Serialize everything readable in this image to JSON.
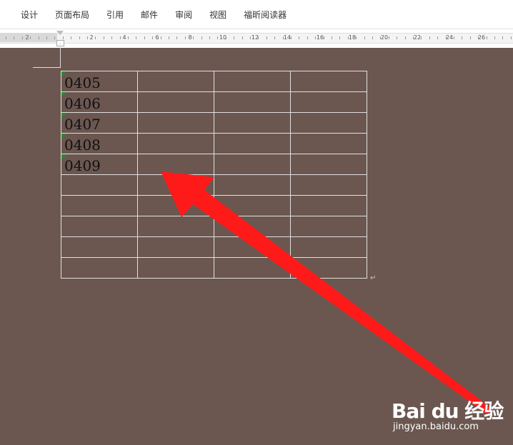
{
  "menu": [
    "设计",
    "页面布局",
    "引用",
    "邮件",
    "审阅",
    "视图",
    "福昕阅读器"
  ],
  "ruler": {
    "labels": [
      "2",
      "",
      "2",
      "4",
      "6",
      "8",
      "10",
      "12",
      "14",
      "16",
      "18",
      "20",
      "22",
      "24",
      "26"
    ]
  },
  "table": {
    "rows": [
      [
        "0405",
        "",
        "",
        ""
      ],
      [
        "0406",
        "",
        "",
        ""
      ],
      [
        "0407",
        "",
        "",
        ""
      ],
      [
        "0408",
        "",
        "",
        ""
      ],
      [
        "0409",
        "",
        "",
        ""
      ],
      [
        "",
        "",
        "",
        ""
      ],
      [
        "",
        "",
        "",
        ""
      ],
      [
        "",
        "",
        "",
        ""
      ],
      [
        "",
        "",
        "",
        ""
      ],
      [
        "",
        "",
        "",
        ""
      ]
    ]
  },
  "paragraph_mark": "↵",
  "watermark": {
    "logo": "Bai du 经验",
    "url": "jingyan.baidu.com"
  },
  "colors": {
    "canvas": "#6b5750",
    "arrow": "#ff1a1a",
    "indicator": "#1f8f2f"
  }
}
